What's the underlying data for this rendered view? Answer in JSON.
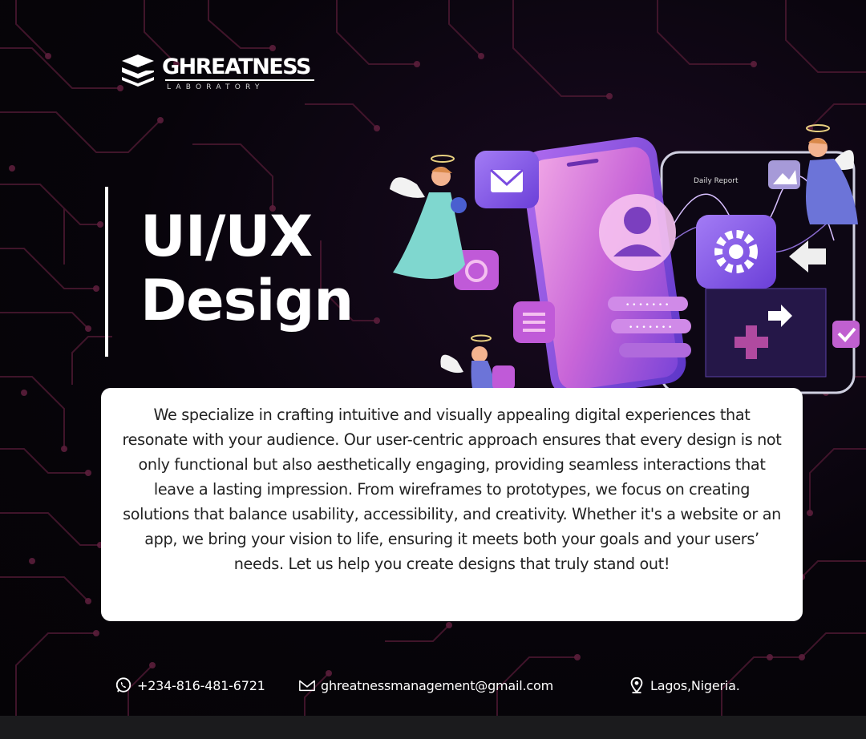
{
  "brand": {
    "name": "GHREATNESS",
    "subtitle": "LABORATORY"
  },
  "headline": {
    "line1": "UI/UX",
    "line2": "Design"
  },
  "description": "We specialize in crafting intuitive and visually appealing digital experiences that resonate with your audience. Our user-centric approach ensures that every design is not only functional but also aesthetically engaging, providing seamless interactions that leave a lasting impression. From wireframes to prototypes, we focus on creating solutions that balance usability, accessibility, and creativity. Whether it's a website or an app, we bring your vision to life, ensuring it meets both your goals and your users’ needs. Let us help you create designs that truly stand out!",
  "illustration": {
    "report_label": "Daily Report"
  },
  "contacts": {
    "phone": "+234-816-481-6721",
    "email": "ghreatnessmanagement@gmail.com",
    "location": "Lagos,Nigeria."
  },
  "colors": {
    "background": "#050306",
    "circuit": "#4a1830",
    "accent_purple": "#8a5cf0",
    "accent_pink": "#e86fd0",
    "card": "#ffffff"
  },
  "icons": {
    "phone": "whatsapp-icon",
    "email": "mail-icon",
    "location": "location-pin-icon"
  }
}
